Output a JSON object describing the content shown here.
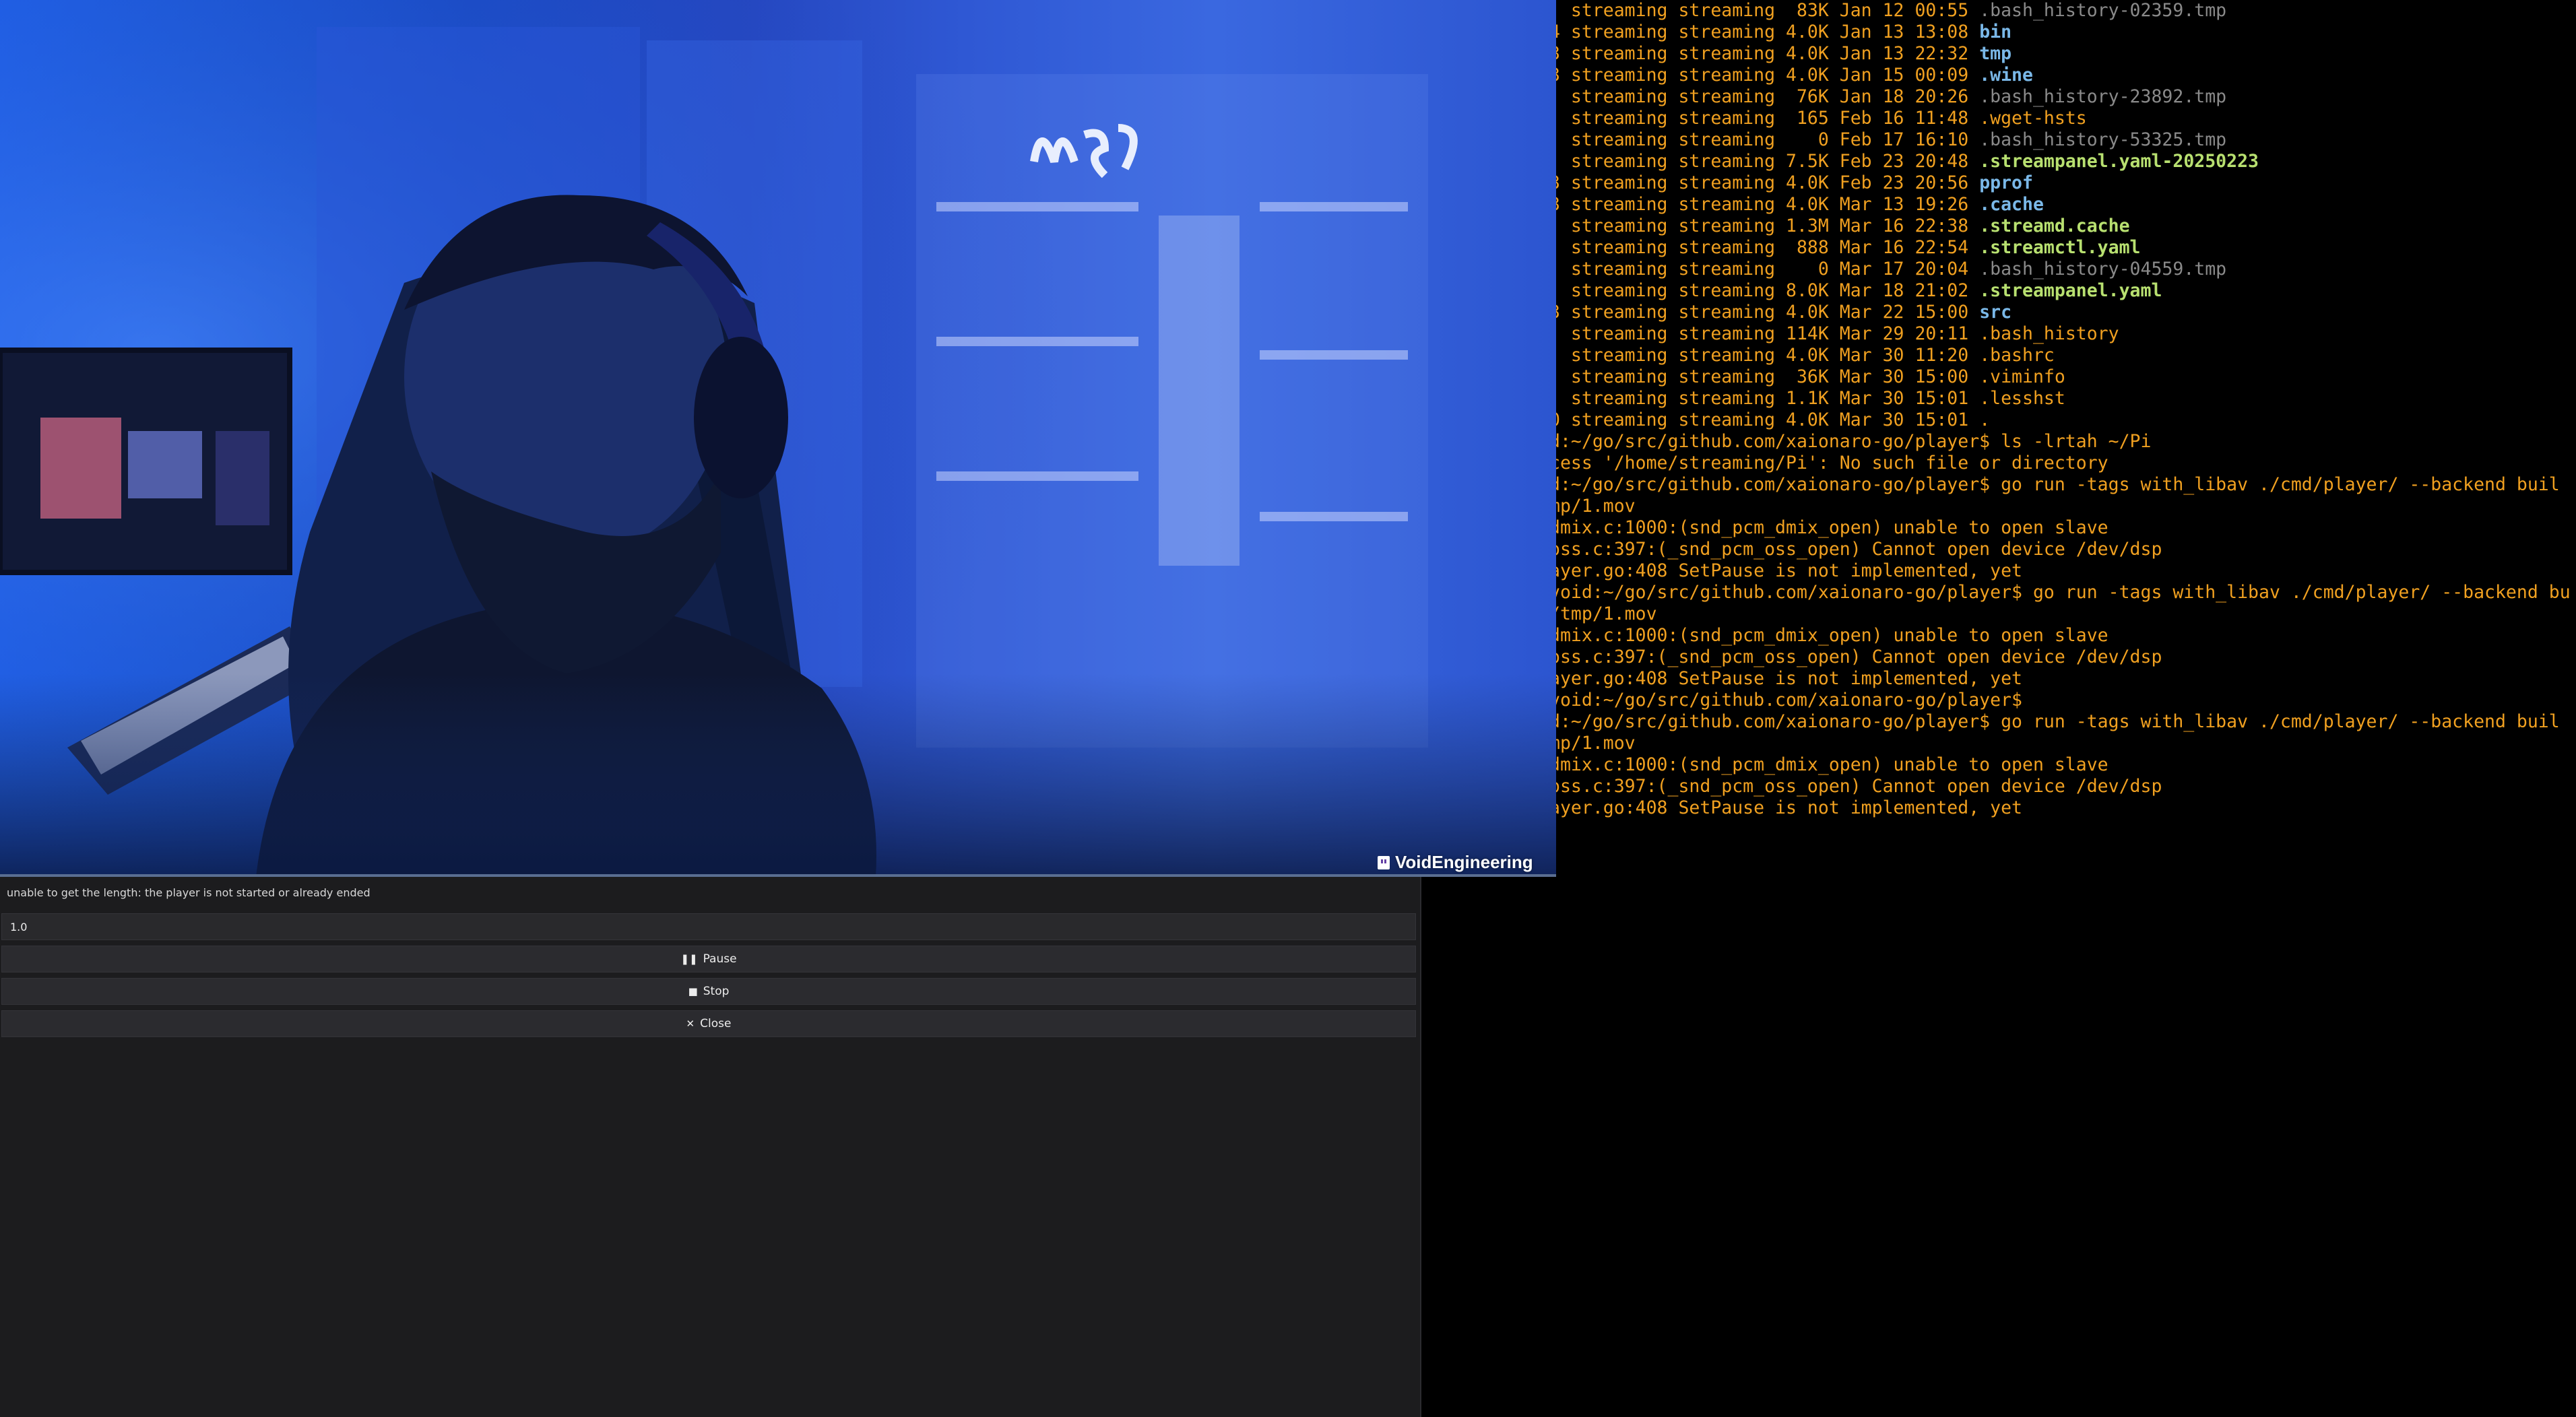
{
  "terminal": {
    "lines": [
      {
        "text": ". streaming streaming  83K Jan 12 00:55 ",
        "name": ".bash_history-02359.tmp",
        "kind": "tmp"
      },
      {
        "text": "4 streaming streaming 4.0K Jan 13 13:08 ",
        "name": "bin",
        "kind": "dir"
      },
      {
        "text": "3 streaming streaming 4.0K Jan 13 22:32 ",
        "name": "tmp",
        "kind": "dir"
      },
      {
        "text": "3 streaming streaming 4.0K Jan 15 00:09 ",
        "name": ".wine",
        "kind": "dir"
      },
      {
        "text": ". streaming streaming  76K Jan 18 20:26 ",
        "name": ".bash_history-23892.tmp",
        "kind": "tmp"
      },
      {
        "text": ". streaming streaming  165 Feb 16 11:48 ",
        "name": ".wget-hsts",
        "kind": "text"
      },
      {
        "text": ". streaming streaming    0 Feb 17 16:10 ",
        "name": ".bash_history-53325.tmp",
        "kind": "tmp"
      },
      {
        "text": ". streaming streaming 7.5K Feb 23 20:48 ",
        "name": ".streampanel.yaml-20250223",
        "kind": "conf"
      },
      {
        "text": "3 streaming streaming 4.0K Feb 23 20:56 ",
        "name": "pprof",
        "kind": "dir"
      },
      {
        "text": "3 streaming streaming 4.0K Mar 13 19:26 ",
        "name": ".cache",
        "kind": "dir"
      },
      {
        "text": ". streaming streaming 1.3M Mar 16 22:38 ",
        "name": ".streamd.cache",
        "kind": "conf"
      },
      {
        "text": ". streaming streaming  888 Mar 16 22:54 ",
        "name": ".streamctl.yaml",
        "kind": "conf"
      },
      {
        "text": ". streaming streaming    0 Mar 17 20:04 ",
        "name": ".bash_history-04559.tmp",
        "kind": "tmp"
      },
      {
        "text": ". streaming streaming 8.0K Mar 18 21:02 ",
        "name": ".streampanel.yaml",
        "kind": "conf"
      },
      {
        "text": "3 streaming streaming 4.0K Mar 22 15:00 ",
        "name": "src",
        "kind": "dir"
      },
      {
        "text": ". streaming streaming 114K Mar 29 20:11 ",
        "name": ".bash_history",
        "kind": "text"
      },
      {
        "text": ". streaming streaming 4.0K Mar 30 11:20 ",
        "name": ".bashrc",
        "kind": "text"
      },
      {
        "text": ". streaming streaming  36K Mar 30 15:00 ",
        "name": ".viminfo",
        "kind": "text"
      },
      {
        "text": ". streaming streaming 1.1K Mar 30 15:01 ",
        "name": ".lesshst",
        "kind": "text"
      },
      {
        "text": "0 streaming streaming 4.0K Mar 30 15:01 ",
        "name": ".",
        "kind": "text"
      },
      {
        "text": "d:~/go/src/github.com/xaionaro-go/player$ ls -lrtah ~/Pi",
        "name": "",
        "kind": "text"
      },
      {
        "text": "cess '/home/streaming/Pi': No such file or directory",
        "name": "",
        "kind": "text"
      },
      {
        "text": "d:~/go/src/github.com/xaionaro-go/player$ go run -tags with_libav ./cmd/player/ --backend buil",
        "name": "",
        "kind": "text"
      },
      {
        "text": "mp/1.mov",
        "name": "",
        "kind": "text"
      },
      {
        "text": "dmix.c:1000:(snd_pcm_dmix_open) unable to open slave",
        "name": "",
        "kind": "text"
      },
      {
        "text": "oss.c:397:(_snd_pcm_oss_open) Cannot open device /dev/dsp",
        "name": "",
        "kind": "text"
      },
      {
        "text": "ayer.go:408 SetPause is not implemented, yet",
        "name": "",
        "kind": "text"
      },
      {
        "text": "void:~/go/src/github.com/xaionaro-go/player$ go run -tags with_libav ./cmd/player/ --backend bu",
        "name": "",
        "kind": "text"
      },
      {
        "text": "/tmp/1.mov",
        "name": "",
        "kind": "text"
      },
      {
        "text": "dmix.c:1000:(snd_pcm_dmix_open) unable to open slave",
        "name": "",
        "kind": "text"
      },
      {
        "text": "oss.c:397:(_snd_pcm_oss_open) Cannot open device /dev/dsp",
        "name": "",
        "kind": "text"
      },
      {
        "text": "ayer.go:408 SetPause is not implemented, yet",
        "name": "",
        "kind": "text"
      },
      {
        "text": "void:~/go/src/github.com/xaionaro-go/player$",
        "name": "",
        "kind": "text"
      },
      {
        "text": "d:~/go/src/github.com/xaionaro-go/player$ go run -tags with_libav ./cmd/player/ --backend buil",
        "name": "",
        "kind": "text"
      },
      {
        "text": "mp/1.mov",
        "name": "",
        "kind": "text"
      },
      {
        "text": "dmix.c:1000:(snd_pcm_dmix_open) unable to open slave",
        "name": "",
        "kind": "text"
      },
      {
        "text": "oss.c:397:(_snd_pcm_oss_open) Cannot open device /dev/dsp",
        "name": "",
        "kind": "text"
      },
      {
        "text": "ayer.go:408 SetPause is not implemented, yet",
        "name": "",
        "kind": "text"
      }
    ]
  },
  "video": {
    "overlay_text": "VoidEngineering",
    "icon": "twitch-icon"
  },
  "player": {
    "status": "unable to get the length: the player is not started or already ended",
    "volume_value": "1.0",
    "pause_label": "Pause",
    "pause_icon": "pause-icon",
    "stop_label": "Stop",
    "stop_icon": "stop-icon",
    "close_label": "Close",
    "close_icon": "close-icon"
  },
  "colors": {
    "terminal_text": "#f0a020",
    "terminal_tmp": "#8a8a8a",
    "terminal_dir": "#7ab8e8",
    "terminal_conf": "#b8e070",
    "panel_bg": "#1c1c1e",
    "button_bg": "#2b2b2f"
  }
}
